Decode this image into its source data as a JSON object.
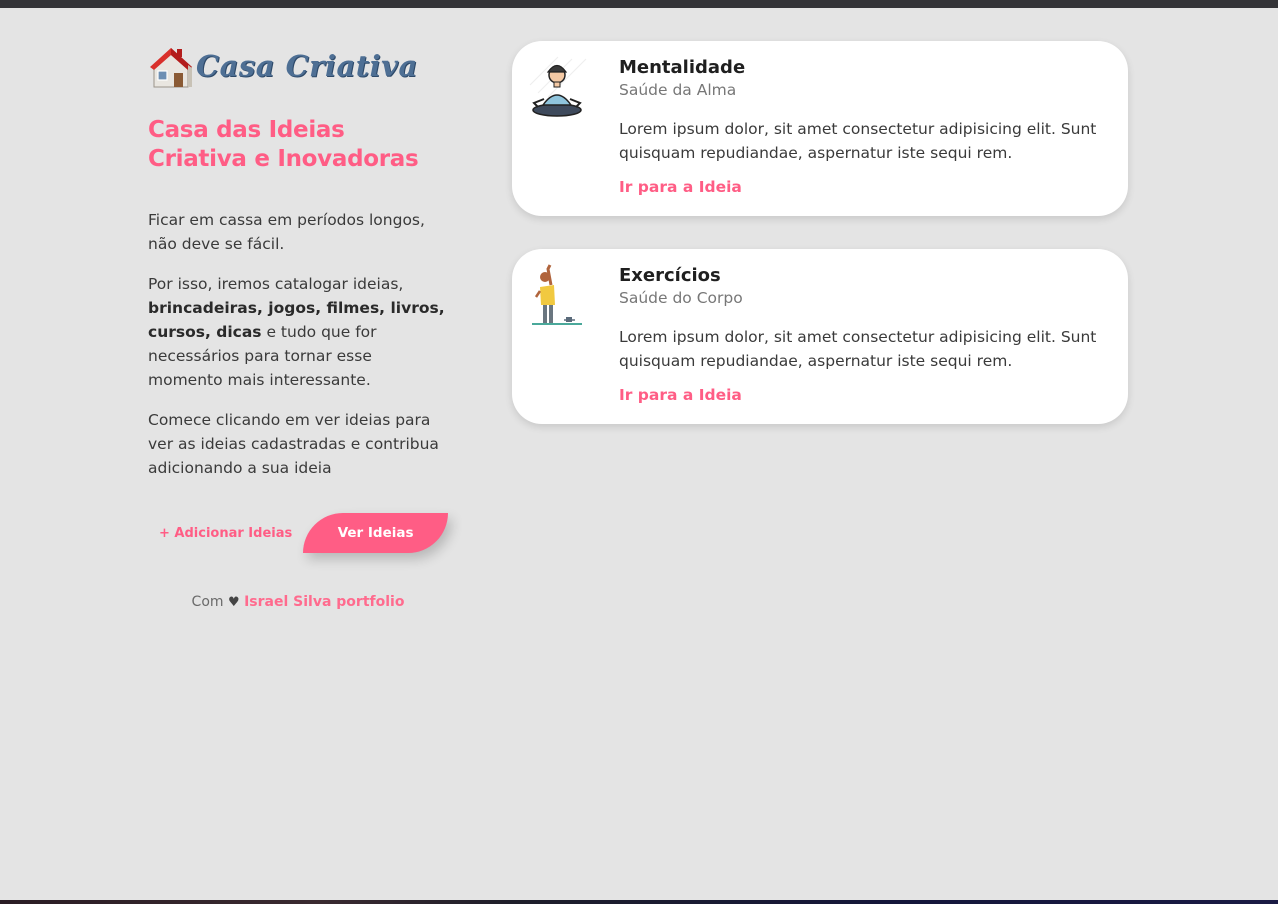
{
  "brand": {
    "name": "Casa Criativa",
    "house_icon": "house-icon"
  },
  "sidebar": {
    "title": "Casa das Ideias Criativa e Inovadoras",
    "paragraph1": "Ficar em cassa em períodos longos, não deve se fácil.",
    "paragraph2_start": "Por isso, iremos catalogar ideias, ",
    "paragraph2_bold": "brincadeiras, jogos, filmes, livros, cursos, dicas",
    "paragraph2_end": " e tudo que for necessários para tornar esse momento mais interessante.",
    "paragraph3": "Comece clicando em ver ideias para ver as ideias cadastradas e contribua adicionando a sua ideia",
    "add_label": "+ Adicionar Ideias",
    "view_label": "Ver Ideias",
    "credit_prefix": "Com",
    "credit_heart": "♥",
    "credit_link": "Israel Silva portfolio"
  },
  "ideas": [
    {
      "title": "Mentalidade",
      "category": "Saúde da Alma",
      "description": "Lorem ipsum dolor, sit amet consectetur adipisicing elit. Sunt quisquam repudiandae, aspernatur iste sequi rem.",
      "link": "Ir para a Ideia",
      "icon": "meditation-icon"
    },
    {
      "title": "Exercícios",
      "category": "Saúde do Corpo",
      "description": "Lorem ipsum dolor, sit amet consectetur adipisicing elit. Sunt quisquam repudiandae, aspernatur iste sequi rem.",
      "link": "Ir para a Ideia",
      "icon": "exercise-icon"
    }
  ],
  "colors": {
    "accent": "#ff5d85",
    "background": "#e4e4e4",
    "card": "#ffffff",
    "logo": "#4e6f94"
  }
}
